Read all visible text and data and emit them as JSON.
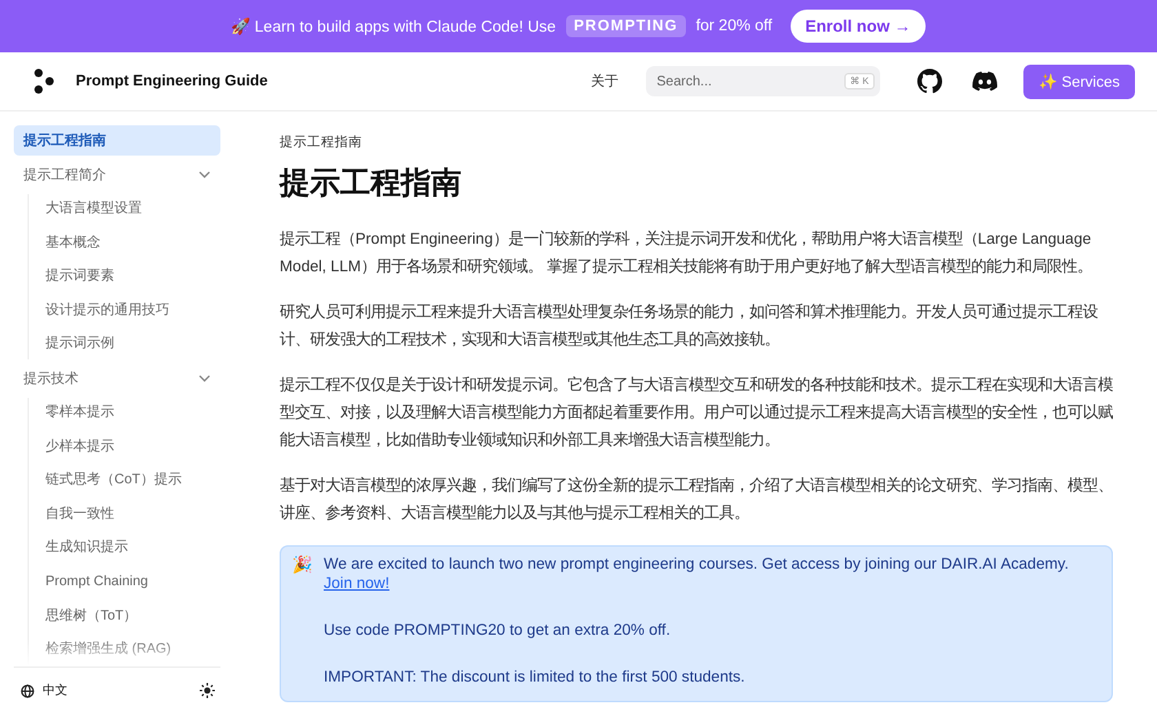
{
  "banner": {
    "emoji": "🚀",
    "text": "Learn to build apps with Claude Code! Use",
    "code": "PROMPTING",
    "suffix": "for 20% off",
    "button": "Enroll now →"
  },
  "header": {
    "title": "Prompt Engineering Guide",
    "about": "关于",
    "search_placeholder": "Search...",
    "shortcut": "⌘ K",
    "services": "✨ Services"
  },
  "sidebar": {
    "items": [
      {
        "label": "提示工程指南",
        "selected": true
      },
      {
        "label": "提示工程简介",
        "selected": false,
        "expanded": true,
        "children": [
          {
            "label": "大语言模型设置",
            "selected": false
          },
          {
            "label": "基本概念",
            "selected": false
          },
          {
            "label": "提示词要素",
            "selected": false
          },
          {
            "label": "设计提示的通用技巧",
            "selected": false
          },
          {
            "label": "提示词示例",
            "selected": false
          }
        ]
      },
      {
        "label": "提示技术",
        "selected": false,
        "expanded": true,
        "children": [
          {
            "label": "零样本提示",
            "selected": false
          },
          {
            "label": "少样本提示",
            "selected": false
          },
          {
            "label": "链式思考（CoT）提示",
            "selected": false
          },
          {
            "label": "自我一致性",
            "selected": false
          },
          {
            "label": "生成知识提示",
            "selected": false
          },
          {
            "label": "Prompt Chaining",
            "selected": false
          },
          {
            "label": "思维树（ToT）",
            "selected": false
          },
          {
            "label": "检索增强生成 (RAG)",
            "selected": false
          }
        ]
      }
    ],
    "language": "中文"
  },
  "main": {
    "breadcrumb": "提示工程指南",
    "title": "提示工程指南",
    "paragraphs": [
      "提示工程（Prompt Engineering）是一门较新的学科，关注提示词开发和优化，帮助用户将大语言模型（Large Language Model, LLM）用于各场景和研究领域。 掌握了提示工程相关技能将有助于用户更好地了解大型语言模型的能力和局限性。",
      "研究人员可利用提示工程来提升大语言模型处理复杂任务场景的能力，如问答和算术推理能力。开发人员可通过提示工程设计、研发强大的工程技术，实现和大语言模型或其他生态工具的高效接轨。",
      "提示工程不仅仅是关于设计和研发提示词。它包含了与大语言模型交互和研发的各种技能和技术。提示工程在实现和大语言模型交互、对接，以及理解大语言模型能力方面都起着重要作用。用户可以通过提示工程来提高大语言模型的安全性，也可以赋能大语言模型，比如借助专业领域知识和外部工具来增强大语言模型能力。",
      "基于对大语言模型的浓厚兴趣，我们编写了这份全新的提示工程指南，介绍了大语言模型相关的论文研究、学习指南、模型、讲座、参考资料、大语言模型能力以及与其他与提示工程相关的工具。"
    ],
    "callout": {
      "emoji": "🎉",
      "text": "We are excited to launch two new prompt engineering courses. Get access by joining our DAIR.AI Academy.",
      "link": "Join now!",
      "lines": [
        "Use code PROMPTING20 to get an extra 20% off.",
        "IMPORTANT: The discount is limited to the first 500 students."
      ]
    }
  }
}
